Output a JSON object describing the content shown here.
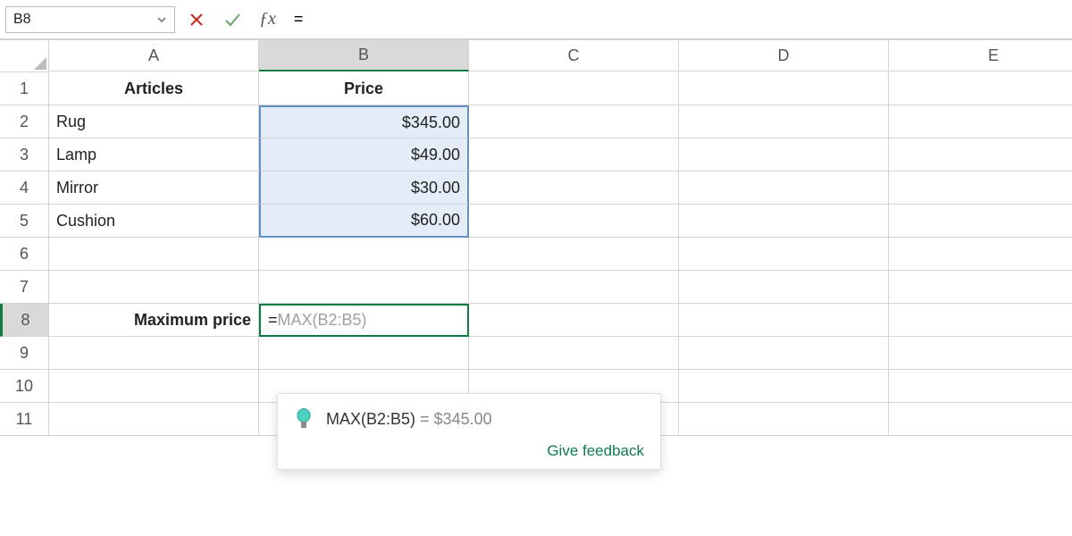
{
  "formulaBar": {
    "nameBox": "B8",
    "formula": "="
  },
  "columns": [
    "A",
    "B",
    "C",
    "D",
    "E"
  ],
  "rows": [
    "1",
    "2",
    "3",
    "4",
    "5",
    "6",
    "7",
    "8",
    "9",
    "10",
    "11"
  ],
  "headers": {
    "A1": "Articles",
    "B1": "Price"
  },
  "data": {
    "A2": "Rug",
    "B2": "$345.00",
    "A3": "Lamp",
    "B3": "$49.00",
    "A4": "Mirror",
    "B4": "$30.00",
    "A5": "Cushion",
    "B5": "$60.00",
    "A8": "Maximum price"
  },
  "editCell": {
    "prefix": "=",
    "ghost": "MAX(B2:B5)"
  },
  "suggestion": {
    "formula": "MAX(B2:B5)",
    "equals": " = ",
    "result": "$345.00",
    "feedback": "Give feedback"
  },
  "colors": {
    "accent": "#107c41",
    "rangeBorder": "#638ec6",
    "cancel": "#c42b1c",
    "accept": "#6ca66c"
  }
}
